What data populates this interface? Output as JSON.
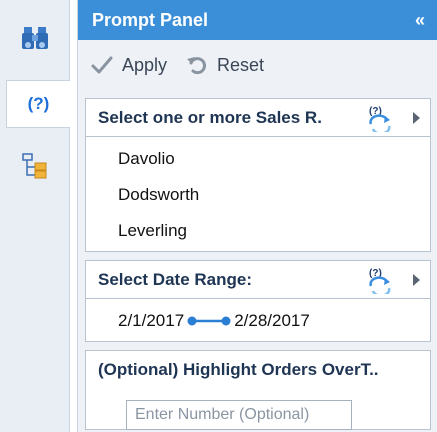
{
  "rail": {
    "prompt_glyph": "(?)"
  },
  "panel": {
    "title": "Prompt Panel",
    "collapse_glyph": "«"
  },
  "toolbar": {
    "apply_label": "Apply",
    "reset_label": "Reset"
  },
  "prompts": {
    "sales_reps": {
      "title": "Select one or more Sales R.",
      "items": [
        "Davolio",
        "Dodsworth",
        "Leverling"
      ]
    },
    "date_range": {
      "title": "Select Date Range:",
      "start": "2/1/2017",
      "end": "2/28/2017"
    },
    "highlight_orders": {
      "title": "(Optional) Highlight Orders OverT..",
      "placeholder": "Enter Number (Optional)",
      "value": ""
    }
  },
  "colors": {
    "header": "#3b8ed8",
    "accent": "#1e6fd9",
    "rail_bg": "#e9eef5",
    "panel_bg": "#eef2f7"
  },
  "icons": {
    "rail": [
      "binoculars-icon",
      "prompt-icon",
      "tree-icon"
    ],
    "toolbar": [
      "check-icon",
      "undo-icon"
    ],
    "cards": [
      "refresh-prompt-icon",
      "expand-arrow-icon"
    ]
  }
}
